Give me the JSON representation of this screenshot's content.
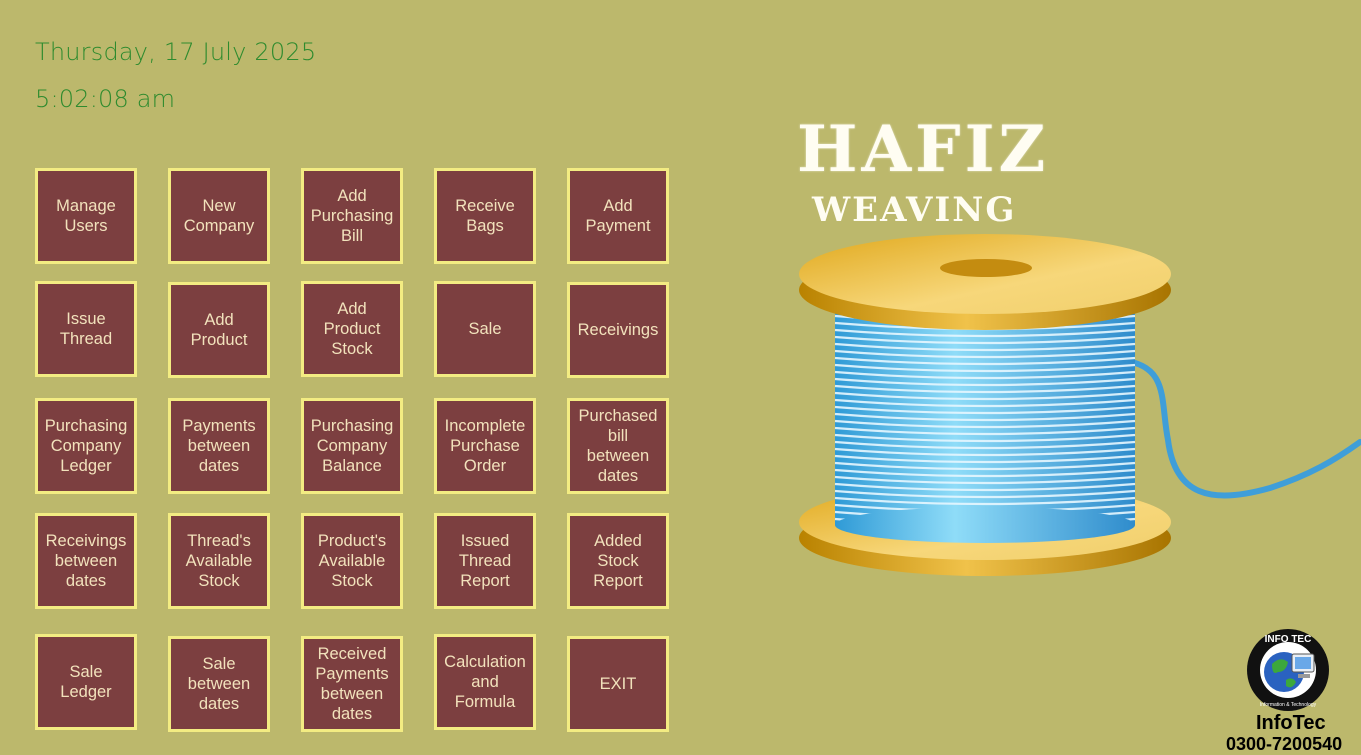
{
  "header": {
    "date": "Thursday, 17 July 2025",
    "time": "5:02:08 am"
  },
  "menu": [
    "Manage\nUsers",
    "New\nCompany",
    "Add\nPurchasing\nBill",
    "Receive\nBags",
    "Add\nPayment",
    "Issue\nThread",
    "Add\nProduct",
    "Add\nProduct\nStock",
    "Sale",
    "Receivings",
    "Purchasing\nCompany\nLedger",
    "Payments\nbetween\ndates",
    "Purchasing\nCompany\nBalance",
    "Incomplete\nPurchase\nOrder",
    "Purchased\nbill\nbetween\ndates",
    "Receivings\nbetween\ndates",
    "Thread's\nAvailable\nStock",
    "Product's\nAvailable\nStock",
    "Issued\nThread\nReport",
    "Added\nStock\nReport",
    "Sale\nLedger",
    "Sale\nbetween\ndates",
    "Received\nPayments\nbetween\ndates",
    "Calculation\nand\nFormula",
    "EXIT"
  ],
  "brand": {
    "line1": "HAFIZ",
    "line2": "WEAVING"
  },
  "footer": {
    "company": "InfoTec",
    "phone": "0300-7200540",
    "logo_text_top": "INFO TEC",
    "logo_text_bottom": "Information & Technology"
  },
  "colors": {
    "background": "#bcb86c",
    "tile": "#7c3f40",
    "tile_border": "#f3ec82",
    "tile_text": "#f2e2bc",
    "datetime": "#2e8b2e",
    "thread": "#5bc4f0",
    "spool": "#d9a11a"
  },
  "icons": [
    "thread-spool-icon",
    "infotec-globe-logo"
  ]
}
